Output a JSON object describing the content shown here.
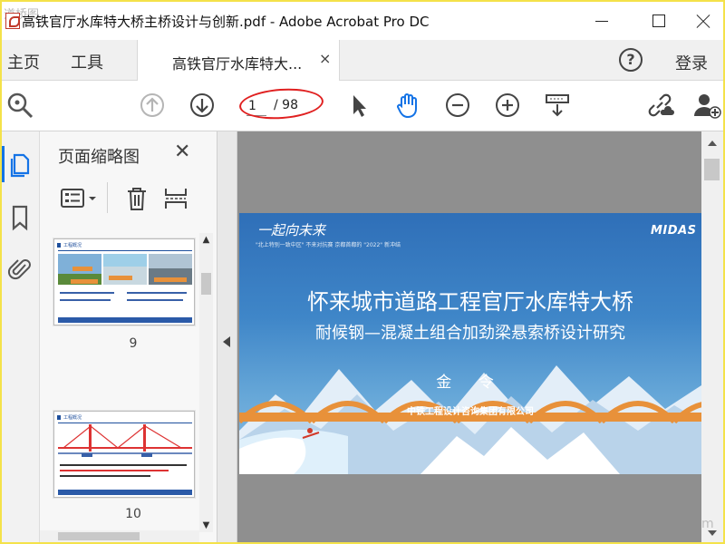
{
  "window": {
    "title": "高铁官厅水库特大桥主桥设计与创新.pdf - Adobe Acrobat Pro DC",
    "watermark": "道桥图"
  },
  "menubar": {
    "home": "主页",
    "tools": "工具",
    "tab_label": "高铁官厅水库特大...",
    "tab_close": "×",
    "login": "登录",
    "help": "?"
  },
  "toolbar": {
    "current_page": "1",
    "total_pages": "/ 98",
    "icons": [
      "search-icon",
      "prev-page-icon",
      "next-page-icon",
      "select-cursor-icon",
      "hand-tool-icon",
      "zoom-out-icon",
      "zoom-in-icon",
      "page-display-icon",
      "share-link-icon",
      "add-user-icon"
    ]
  },
  "panel": {
    "title": "页面缩略图",
    "close": "✕",
    "thumbnails": [
      {
        "page": "9",
        "header": "工程概况"
      },
      {
        "page": "10",
        "header": "工程概况"
      }
    ]
  },
  "slide": {
    "brand": "一起向未来",
    "tiny_text": "\"北上特别一致中区\" 不来对抗赛 京都首都的 \"2022\" 新冲结",
    "logo": "MIDAS",
    "title": "怀来城市道路工程官厅水库特大桥",
    "subtitle": "耐候钢—混凝土组合加劲梁悬索桥设计研究",
    "author": "金 令",
    "org": "中铁工程设计咨询集团有限公司"
  },
  "colors": {
    "accent": "#1473e6",
    "annotation": "#e02020",
    "frame": "#f4e24a",
    "slide_blue": "#3f86c8",
    "bridge_orange": "#e8913a"
  },
  "corner_mark": "m"
}
